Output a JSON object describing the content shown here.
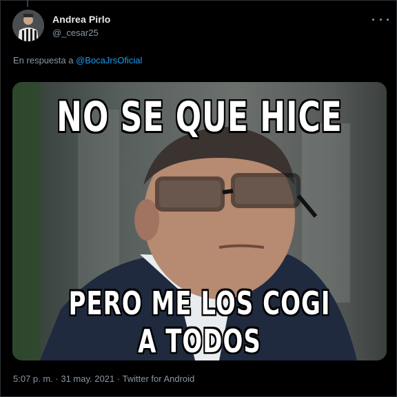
{
  "tweet": {
    "display_name": "Andrea Pirlo",
    "handle": "@_cesar25",
    "reply_prefix": "En respuesta a",
    "reply_to": "@BocaJrsOficial",
    "more_icon": "more-options-icon",
    "timestamp": "5:07 p. m. · 31 may. 2021 · Twitter for Android"
  },
  "media": {
    "caption_top": "NO SE QUE HICE",
    "caption_bottom_line1": "PERO ME LOS COGI",
    "caption_bottom_line2": "A TODOS"
  },
  "colors": {
    "background": "#000000",
    "text_primary": "#e7e9ea",
    "text_secondary": "#8b98a5",
    "link": "#1d9bf0"
  }
}
